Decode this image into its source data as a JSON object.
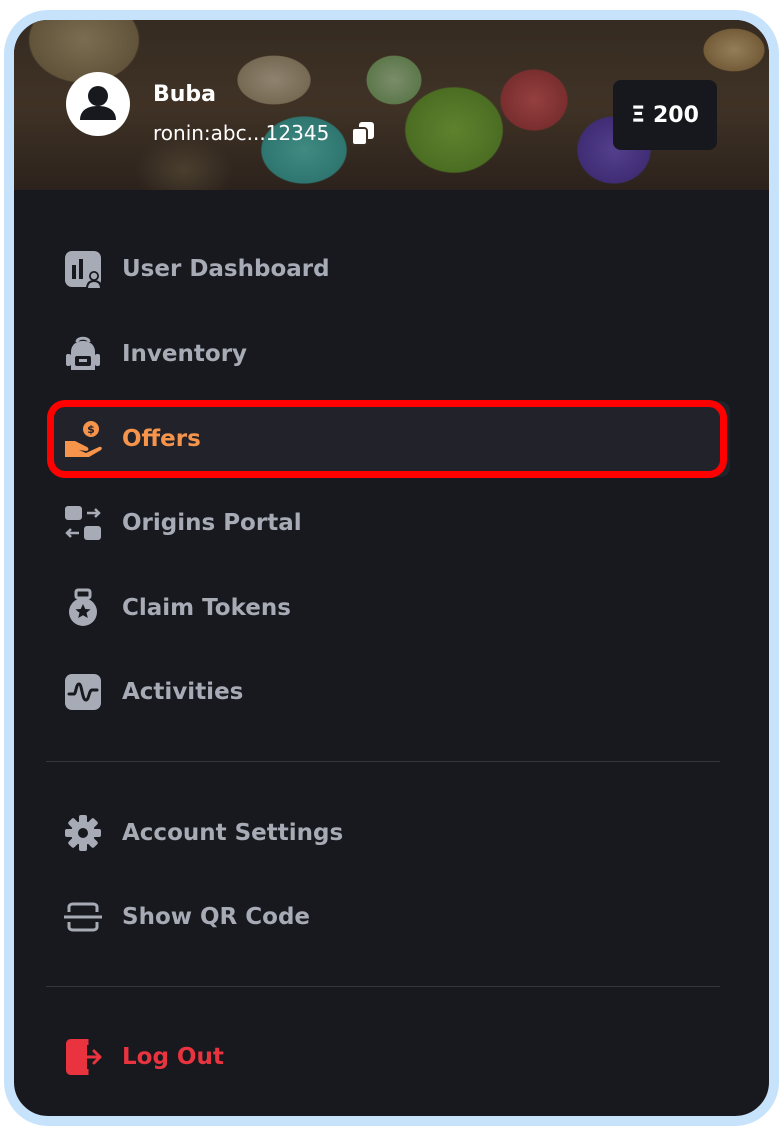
{
  "user": {
    "name": "Buba",
    "address": "ronin:abc...12345",
    "balance_symbol": "Ξ",
    "balance": "200"
  },
  "menu": {
    "items": [
      {
        "label": "User Dashboard",
        "icon": "dashboard-icon"
      },
      {
        "label": "Inventory",
        "icon": "backpack-icon"
      },
      {
        "label": "Offers",
        "icon": "offers-icon",
        "active": true
      },
      {
        "label": "Origins Portal",
        "icon": "portal-icon"
      },
      {
        "label": "Claim Tokens",
        "icon": "medal-icon"
      },
      {
        "label": "Activities",
        "icon": "activity-icon"
      }
    ],
    "settings": [
      {
        "label": "Account Settings",
        "icon": "gear-icon"
      },
      {
        "label": "Show QR Code",
        "icon": "qr-scan-icon"
      }
    ],
    "logout": {
      "label": "Log Out",
      "icon": "logout-icon"
    }
  },
  "colors": {
    "background": "#18191e",
    "text": "#a7abb6",
    "active": "#f6944b",
    "danger": "#e9343f",
    "highlight": "#ff0000"
  }
}
